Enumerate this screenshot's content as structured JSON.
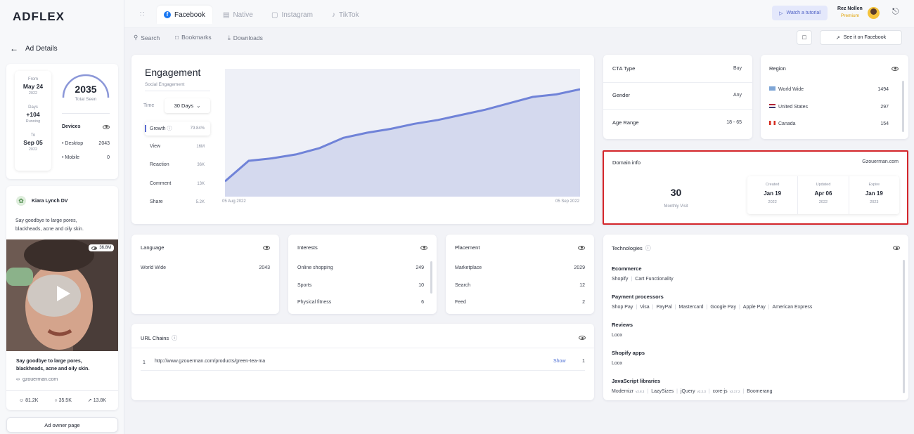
{
  "brand": {
    "logo": "ADFLEX"
  },
  "nav": {
    "back_label": "Ad Details",
    "tabs": [
      {
        "label": "Facebook",
        "icon": "facebook-icon"
      },
      {
        "label": "Native",
        "icon": "native-icon"
      },
      {
        "label": "Instagram",
        "icon": "instagram-icon"
      },
      {
        "label": "TikTok",
        "icon": "tiktok-icon"
      }
    ],
    "subnav": [
      {
        "label": "Search",
        "icon": "search-icon"
      },
      {
        "label": "Bookmarks",
        "icon": "bookmark-icon"
      },
      {
        "label": "Downloads",
        "icon": "download-icon"
      }
    ],
    "tutorial_label": "Watch a tutorial",
    "see_label": "See it on Facebook"
  },
  "user": {
    "name": "Rez Nollen",
    "plan": "Premium"
  },
  "summary": {
    "from_label": "From",
    "from_date": "May 24",
    "from_year": "2022",
    "days_label": "Days",
    "days_value": "+104",
    "days_status": "Running",
    "to_label": "To",
    "to_date": "Sep 05",
    "to_year": "2022",
    "total_seen": "2035",
    "total_seen_label": "Total Seen",
    "devices_label": "Devices",
    "devices": [
      {
        "label": "Desktop",
        "value": "2043"
      },
      {
        "label": "Mobile",
        "value": "0"
      }
    ]
  },
  "ad": {
    "advertiser": "Kiara Lynch DV",
    "text": "Say goodbye to large pores, blackheads, acne and oily skin.",
    "views": "36.8M",
    "headline": "Say goodbye to large pores, blackheads, acne and oily skin.",
    "domain": "gzouerman.com",
    "likes": "81.2K",
    "comments": "35.5K",
    "shares": "13.8K",
    "owner_button": "Ad owner page"
  },
  "engagement": {
    "title": "Engagement",
    "subtitle": "Social Engagement",
    "time_label": "Time",
    "time_value": "30 Days",
    "metrics": [
      {
        "label": "Growth",
        "value": "79.84%"
      },
      {
        "label": "View",
        "value": "16M"
      },
      {
        "label": "Reaction",
        "value": "36K"
      },
      {
        "label": "Comment",
        "value": "13K"
      },
      {
        "label": "Share",
        "value": "5.2K"
      }
    ],
    "x_start": "05 Aug 2022",
    "x_end": "05 Sep 2022"
  },
  "chart_data": {
    "type": "area",
    "x": [
      "05 Aug 2022",
      "05 Sep 2022"
    ],
    "values": [
      0.12,
      0.28,
      0.3,
      0.33,
      0.38,
      0.46,
      0.5,
      0.53,
      0.57,
      0.6,
      0.64,
      0.68,
      0.73,
      0.78,
      0.8,
      0.84
    ],
    "color": "#7083d8",
    "fill": "#d4d9ee"
  },
  "targeting": {
    "cta_label": "CTA Type",
    "cta_value": "Buy",
    "gender_label": "Gender",
    "gender_value": "Any",
    "age_label": "Age Range",
    "age_value": "18 - 65"
  },
  "region": {
    "title": "Region",
    "items": [
      {
        "label": "World Wide",
        "value": "1494"
      },
      {
        "label": "United States",
        "value": "297"
      },
      {
        "label": "Canada",
        "value": "154"
      }
    ]
  },
  "domain_info": {
    "title": "Domain info",
    "domain": "Gzouerman.com",
    "visits": "30",
    "visits_label": "Monthly Visit",
    "created_label": "Created",
    "created_date": "Jan 19",
    "created_year": "2022",
    "updated_label": "Updated",
    "updated_date": "Apr 06",
    "updated_year": "2022",
    "expire_label": "Expire",
    "expire_date": "Jan 19",
    "expire_year": "2023"
  },
  "language": {
    "title": "Language",
    "items": [
      {
        "label": "World Wide",
        "value": "2043"
      }
    ]
  },
  "interests": {
    "title": "Interests",
    "items": [
      {
        "label": "Online shopping",
        "value": "249"
      },
      {
        "label": "Sports",
        "value": "10"
      },
      {
        "label": "Physical fitness",
        "value": "6"
      }
    ]
  },
  "placement": {
    "title": "Placement",
    "items": [
      {
        "label": "Marketplace",
        "value": "2029"
      },
      {
        "label": "Search",
        "value": "12"
      },
      {
        "label": "Feed",
        "value": "2"
      }
    ]
  },
  "url_chains": {
    "title": "URL Chains",
    "items": [
      {
        "index": "1",
        "url": "http://www.gzouerman.com/products/green-tea-ma",
        "action": "Show",
        "count": "1"
      }
    ]
  },
  "technologies": {
    "title": "Technologies",
    "groups": [
      {
        "title": "Ecommerce",
        "items": [
          "Shopify",
          "Cart Functionality"
        ]
      },
      {
        "title": "Payment processors",
        "items": [
          "Shop Pay",
          "Visa",
          "PayPal",
          "Mastercard",
          "Google Pay",
          "Apple Pay",
          "American Express"
        ]
      },
      {
        "title": "Reviews",
        "items": [
          "Loox"
        ]
      },
      {
        "title": "Shopify apps",
        "items": [
          "Loox"
        ]
      }
    ],
    "js_title": "JavaScript libraries",
    "js": [
      {
        "name": "Modernizr",
        "version": "v2.8.3"
      },
      {
        "name": "LazySizes",
        "version": ""
      },
      {
        "name": "jQuery",
        "version": "v2.2.3"
      },
      {
        "name": "core-js",
        "version": "v3.17.2"
      },
      {
        "name": "Boomerang",
        "version": ""
      }
    ]
  }
}
